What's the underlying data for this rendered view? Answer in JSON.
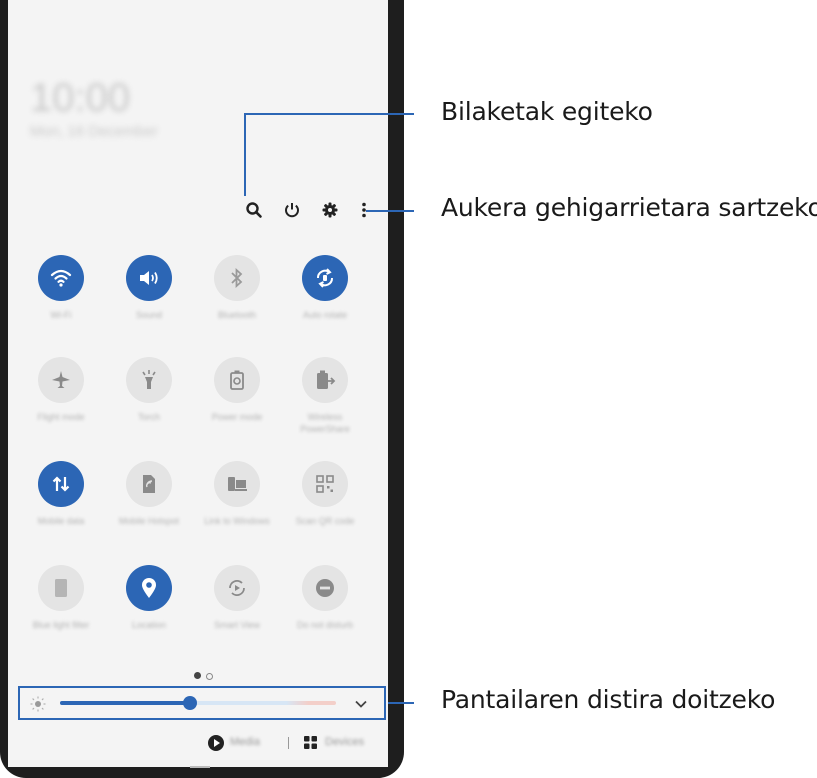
{
  "lock_screen": {
    "clock": "10:00",
    "date": "Mon, 16 December"
  },
  "top_icons": [
    "search-icon",
    "power-icon",
    "gear-icon",
    "more-icon"
  ],
  "tiles": [
    {
      "label": "Wi-Fi",
      "icon": "wifi-icon",
      "on": true
    },
    {
      "label": "Sound",
      "icon": "sound-icon",
      "on": true
    },
    {
      "label": "Bluetooth",
      "icon": "bluetooth-icon",
      "on": false
    },
    {
      "label": "Auto rotate",
      "icon": "autorotate-icon",
      "on": true
    },
    {
      "label": "Flight mode",
      "icon": "airplane-icon",
      "on": false
    },
    {
      "label": "Torch",
      "icon": "torch-icon",
      "on": false
    },
    {
      "label": "Power mode",
      "icon": "power-mode-icon",
      "on": false
    },
    {
      "label": "Wireless PowerShare",
      "icon": "powershare-icon",
      "on": false
    },
    {
      "label": "Mobile data",
      "icon": "mobile-data-icon",
      "on": true
    },
    {
      "label": "Mobile Hotspot",
      "icon": "hotspot-icon",
      "on": false
    },
    {
      "label": "Link to Windows",
      "icon": "link-windows-icon",
      "on": false
    },
    {
      "label": "Scan QR code",
      "icon": "qr-icon",
      "on": false
    },
    {
      "label": "Blue light filter",
      "icon": "bluelight-icon",
      "on": false
    },
    {
      "label": "Location",
      "icon": "location-icon",
      "on": true
    },
    {
      "label": "Smart View",
      "icon": "smartview-icon",
      "on": false
    },
    {
      "label": "Do not disturb",
      "icon": "dnd-icon",
      "on": false
    }
  ],
  "page_indicator": {
    "current": 1,
    "total": 2
  },
  "brightness": {
    "level": 0.47
  },
  "bottom_bar": {
    "media_label": "Media",
    "devices_label": "Devices"
  },
  "callouts": {
    "search": "Bilaketak egiteko",
    "more": "Aukera gehigarrietara sartzeko",
    "brightness": "Pantailaren distira doitzeko"
  },
  "colors": {
    "accent": "#2c66b5",
    "tile_off": "#e4e4e4",
    "background": "#f4f4f4"
  }
}
